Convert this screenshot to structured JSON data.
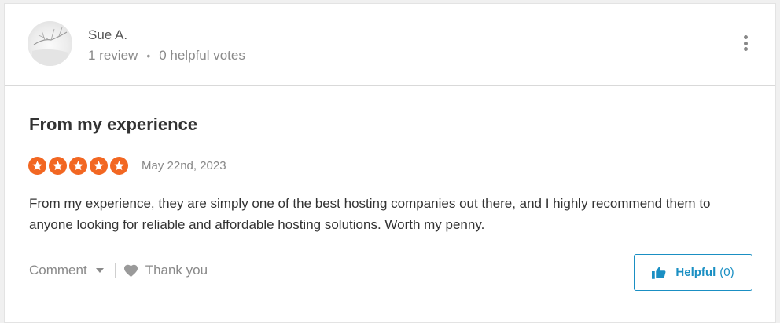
{
  "user": {
    "name": "Sue A.",
    "reviews": "1 review",
    "separator": "•",
    "helpful_votes": "0 helpful votes"
  },
  "review": {
    "title": "From my experience",
    "rating": 5,
    "rating_max": 5,
    "date": "May 22nd, 2023",
    "body": "From my experience, they are simply one of the best hosting companies out there, and I highly recommend them to anyone looking for reliable and affordable hosting solutions. Worth my penny."
  },
  "actions": {
    "comment_label": "Comment",
    "thank_label": "Thank you",
    "helpful_label": "Helpful",
    "helpful_count": "(0)"
  },
  "icons": {
    "menu": "kebab-menu-icon",
    "star": "star-icon",
    "heart": "heart-icon",
    "thumb": "thumbs-up-icon",
    "caret": "chevron-down-icon"
  },
  "colors": {
    "star": "#f26722",
    "accent": "#1a8fc3",
    "muted": "#8a8a8a",
    "heart": "#9a9a9a"
  }
}
